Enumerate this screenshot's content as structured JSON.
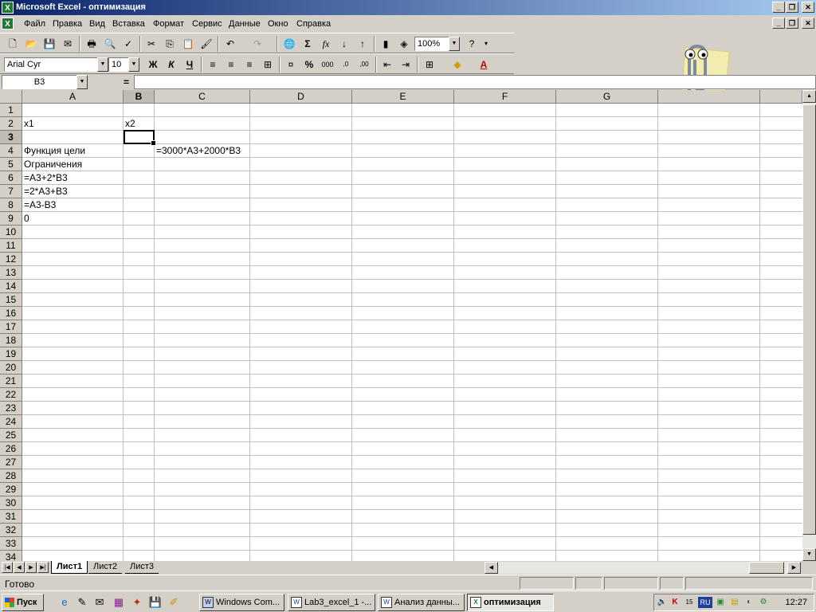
{
  "window": {
    "title": "Microsoft Excel - оптимизация",
    "app_icon": "excel-icon"
  },
  "menu": [
    "Файл",
    "Правка",
    "Вид",
    "Вставка",
    "Формат",
    "Сервис",
    "Данные",
    "Окно",
    "Справка"
  ],
  "toolbar": {
    "zoom": "100%",
    "font": "Arial Cyr",
    "size": "10",
    "bold": "Ж",
    "italic": "К",
    "underline": "Ч",
    "sum": "Σ",
    "fx": "fx",
    "percent": "%",
    "thousands": "000"
  },
  "formula_bar": {
    "name_box": "B3",
    "equals": "=",
    "formula": ""
  },
  "columns": [
    "A",
    "B",
    "C",
    "D",
    "E",
    "F",
    "G"
  ],
  "rows": [
    "1",
    "2",
    "3",
    "4",
    "5",
    "6",
    "7",
    "8",
    "9",
    "10",
    "11",
    "12",
    "13",
    "14",
    "15",
    "16",
    "17",
    "18",
    "19",
    "20",
    "21",
    "22",
    "23",
    "24",
    "25",
    "26",
    "27",
    "28",
    "29",
    "30",
    "31",
    "32",
    "33",
    "34"
  ],
  "cells": {
    "A2": "x1",
    "B2": "x2",
    "A4": "Функция цели",
    "C4": "=3000*A3+2000*B3",
    "A5": "Ограничения",
    "A6": "=A3+2*B3",
    "A7": "=2*A3+B3",
    "A8": "=A3-B3",
    "A9": "0"
  },
  "sheets": [
    "Лист1",
    "Лист2",
    "Лист3"
  ],
  "status": "Готово",
  "taskbar": {
    "start": "Пуск",
    "tasks": [
      "Windows Com...",
      "Lab3_excel_1 -...",
      "Анализ данны...",
      "оптимизация"
    ],
    "lang": "RU",
    "clock": "12:27"
  }
}
